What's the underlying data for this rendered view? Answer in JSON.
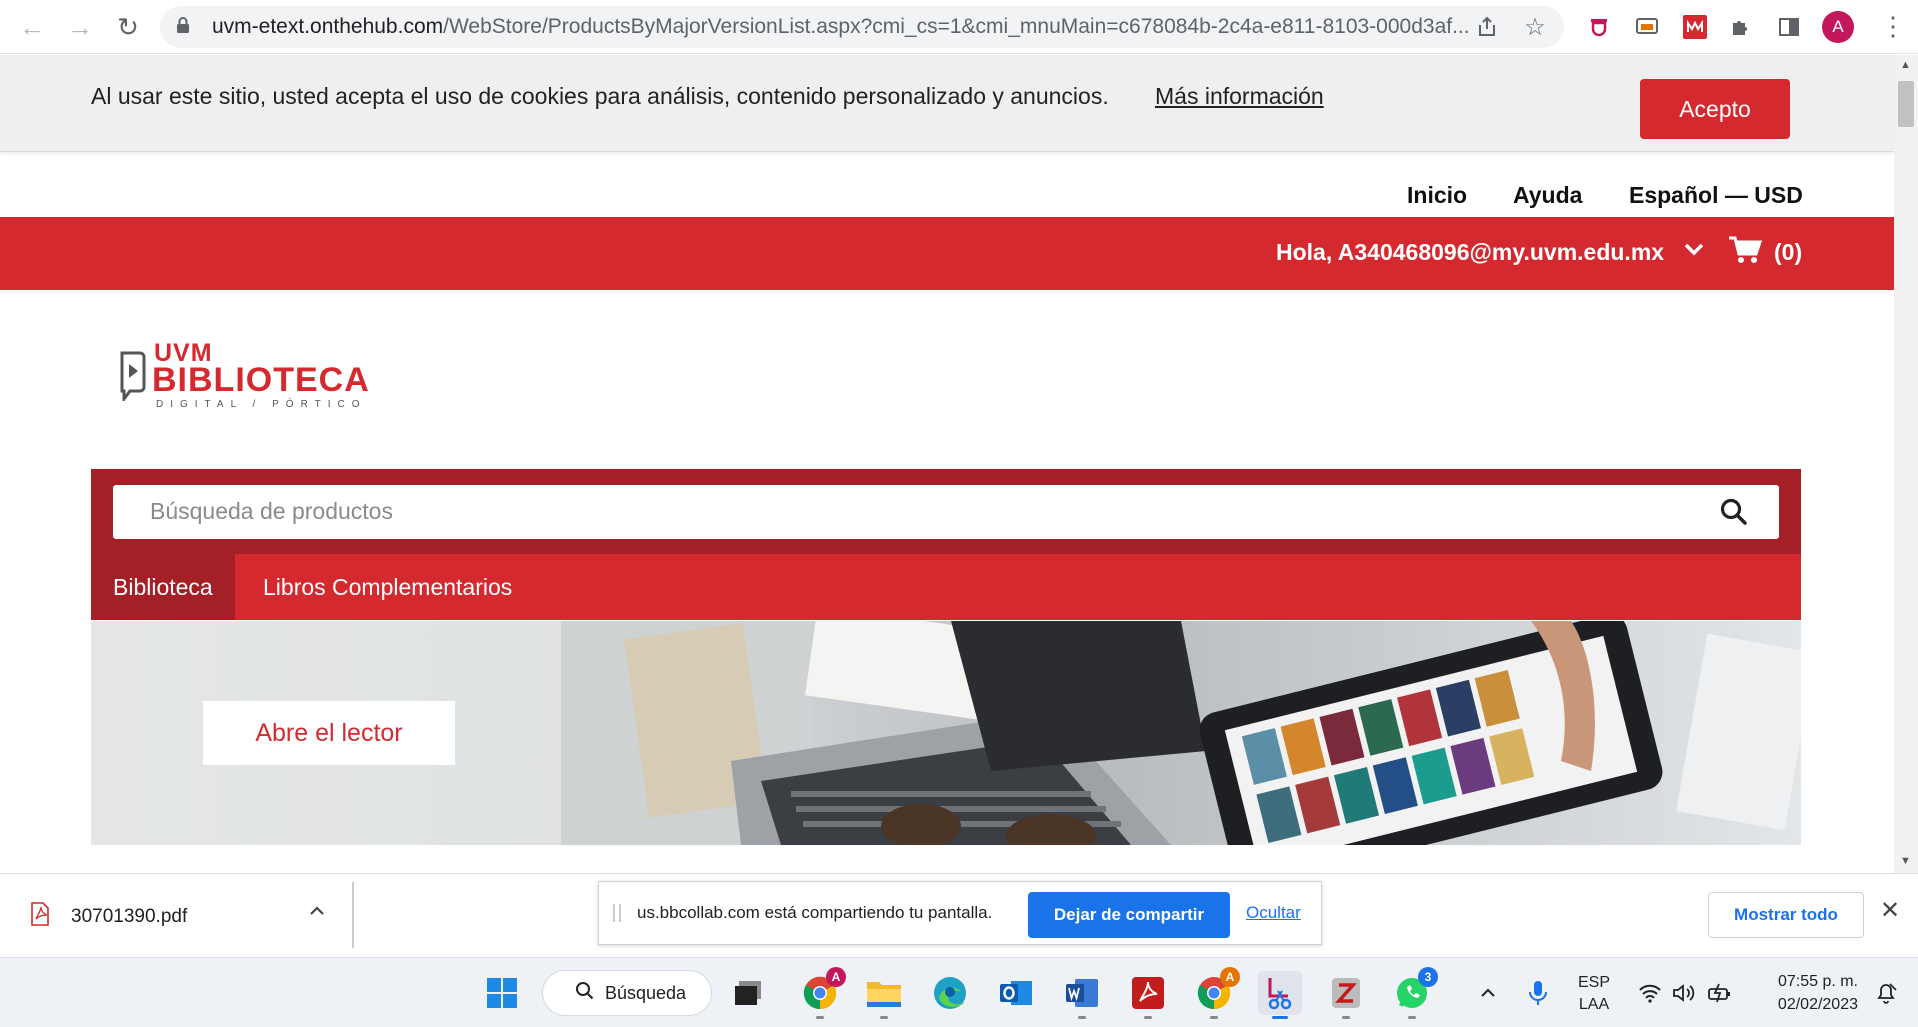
{
  "browser": {
    "url_host": "uvm-etext.onthehub.com",
    "url_path": "/WebStore/ProductsByMajorVersionList.aspx?cmi_cs=1&cmi_mnuMain=c678084b-2c4a-e811-8103-000d3af...",
    "profile_initial": "A",
    "extensions": [
      "shield-extension-icon",
      "cast-extension-icon",
      "grid-extension-icon",
      "puzzle-extension-icon",
      "sidepanel-icon"
    ]
  },
  "cookie_banner": {
    "text": "Al usar este sitio, usted acepta el uso de cookies para análisis, contenido personalizado y anuncios.",
    "link": "Más información",
    "button": "Acepto"
  },
  "top_nav": {
    "home": "Inicio",
    "help": "Ayuda",
    "locale": "Español — USD"
  },
  "account_bar": {
    "greeting": "Hola, A340468096@my.uvm.edu.mx",
    "cart_count": "(0)"
  },
  "logo": {
    "line1": "UVM",
    "line2": "BIBLIOTECA",
    "line3": "DIGITAL / PÓRTICO"
  },
  "search": {
    "placeholder": "Búsqueda de productos"
  },
  "tabs": [
    {
      "label": "Biblioteca",
      "active": true
    },
    {
      "label": "Libros Complementarios",
      "active": false
    }
  ],
  "hero": {
    "button": "Abre el lector"
  },
  "download_bar": {
    "file_name": "30701390.pdf",
    "share_text": "us.bbcollab.com está compartiendo tu pantalla.",
    "stop_share": "Dejar de compartir",
    "hide": "Ocultar",
    "show_all": "Mostrar todo"
  },
  "taskbar": {
    "search_label": "Búsqueda",
    "lang_line1": "ESP",
    "lang_line2": "LAA",
    "time": "07:55 p. m.",
    "date": "02/02/2023",
    "whatsapp_badge": "3",
    "chrome_badge": "A"
  },
  "colors": {
    "brand_red": "#d42a2f",
    "brand_dark_red": "#a51f26",
    "link_blue": "#1a73e8"
  }
}
